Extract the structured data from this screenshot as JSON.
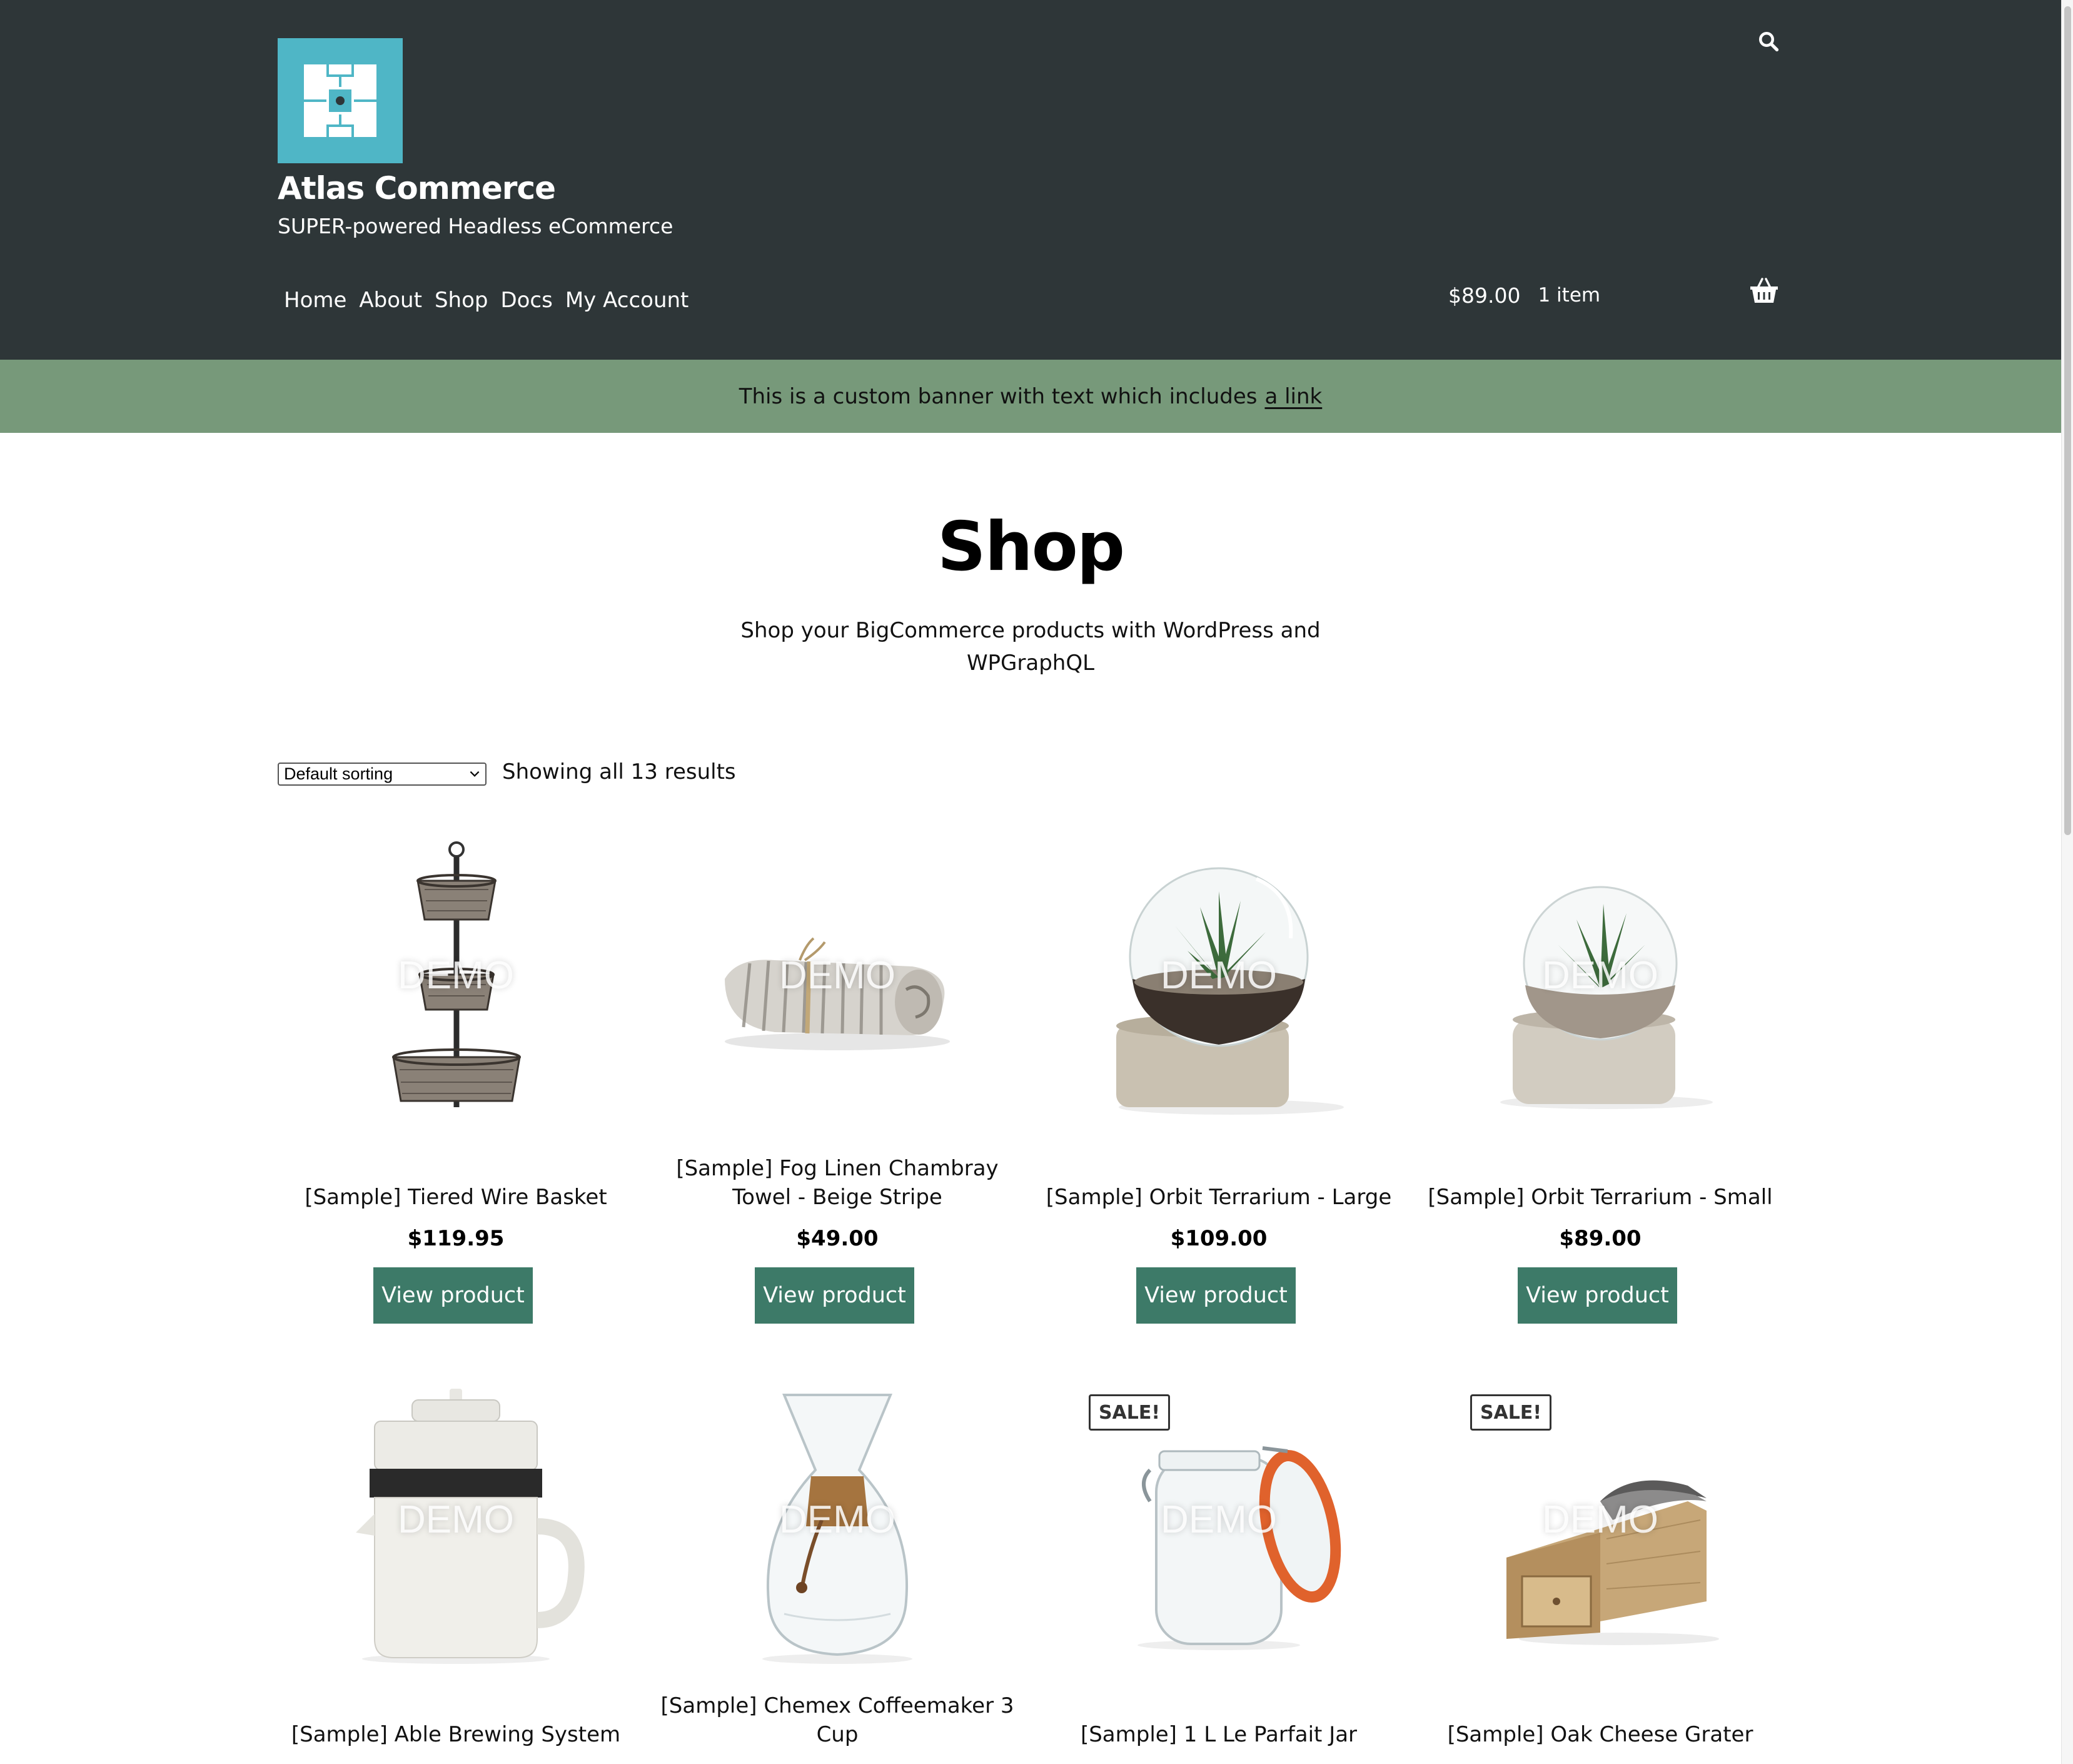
{
  "site": {
    "title": "Atlas Commerce",
    "tagline": "SUPER-powered Headless eCommerce"
  },
  "nav": {
    "items": [
      {
        "label": "Home"
      },
      {
        "label": "About"
      },
      {
        "label": "Shop"
      },
      {
        "label": "Docs"
      },
      {
        "label": "My Account"
      }
    ]
  },
  "header": {
    "search_icon": "search-icon",
    "cart_total": "$89.00",
    "cart_count": "1 item",
    "basket_icon": "basket-icon"
  },
  "banner": {
    "text": "This is a custom banner with text which includes",
    "link_text": "a link",
    "color": "#77997a"
  },
  "main": {
    "title": "Shop",
    "description": "Shop your BigCommerce products with WordPress and WPGraphQL"
  },
  "toolbar": {
    "sort_selected": "Default sorting",
    "result_count": "Showing all 13 results"
  },
  "watermark": "DEMO",
  "products": [
    {
      "name": "[Sample] Tiered Wire Basket",
      "price": "$119.95",
      "button": "View product",
      "sale": null
    },
    {
      "name": "[Sample] Fog Linen Chambray Towel - Beige Stripe",
      "price": "$49.00",
      "button": "View product",
      "sale": null
    },
    {
      "name": "[Sample] Orbit Terrarium - Large",
      "price": "$109.00",
      "button": "View product",
      "sale": null
    },
    {
      "name": "[Sample] Orbit Terrarium - Small",
      "price": "$89.00",
      "button": "View product",
      "sale": null
    },
    {
      "name": "[Sample] Able Brewing System",
      "sale": null
    },
    {
      "name": "[Sample] Chemex Coffeemaker 3 Cup",
      "sale": null
    },
    {
      "name": "[Sample] 1 L Le Parfait Jar",
      "sale": "SALE!"
    },
    {
      "name": "[Sample] Oak Cheese Grater",
      "sale": "SALE!"
    }
  ],
  "colors": {
    "header_bg": "#2e3638",
    "logo_bg": "#4fb6c6",
    "button_bg": "#3d7a68"
  }
}
